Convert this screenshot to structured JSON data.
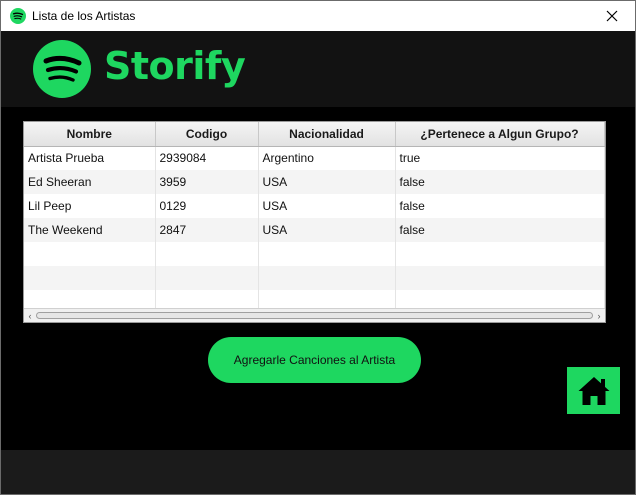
{
  "window": {
    "title": "Lista de los Artistas",
    "icon": "spotify-icon",
    "close_icon": "close-icon"
  },
  "header": {
    "brand": "Storify",
    "logo_icon": "spotify-logo-icon",
    "brand_color": "#1ed760"
  },
  "table": {
    "columns": [
      "Nombre",
      "Codigo",
      "Nacionalidad",
      "¿Pertenece a Algun Grupo?"
    ],
    "rows": [
      [
        "Artista Prueba",
        "2939084",
        "Argentino",
        "true"
      ],
      [
        "Ed Sheeran",
        "3959",
        "USA",
        "false"
      ],
      [
        "Lil Peep",
        "0129",
        "USA",
        "false"
      ],
      [
        "The Weekend",
        "2847",
        "USA",
        "false"
      ]
    ]
  },
  "actions": {
    "add_songs_label": "Agregarle Canciones al Artista",
    "home_icon": "home-icon"
  },
  "colors": {
    "accent": "#1ed760",
    "background": "#000000",
    "header_bg": "#121212"
  }
}
